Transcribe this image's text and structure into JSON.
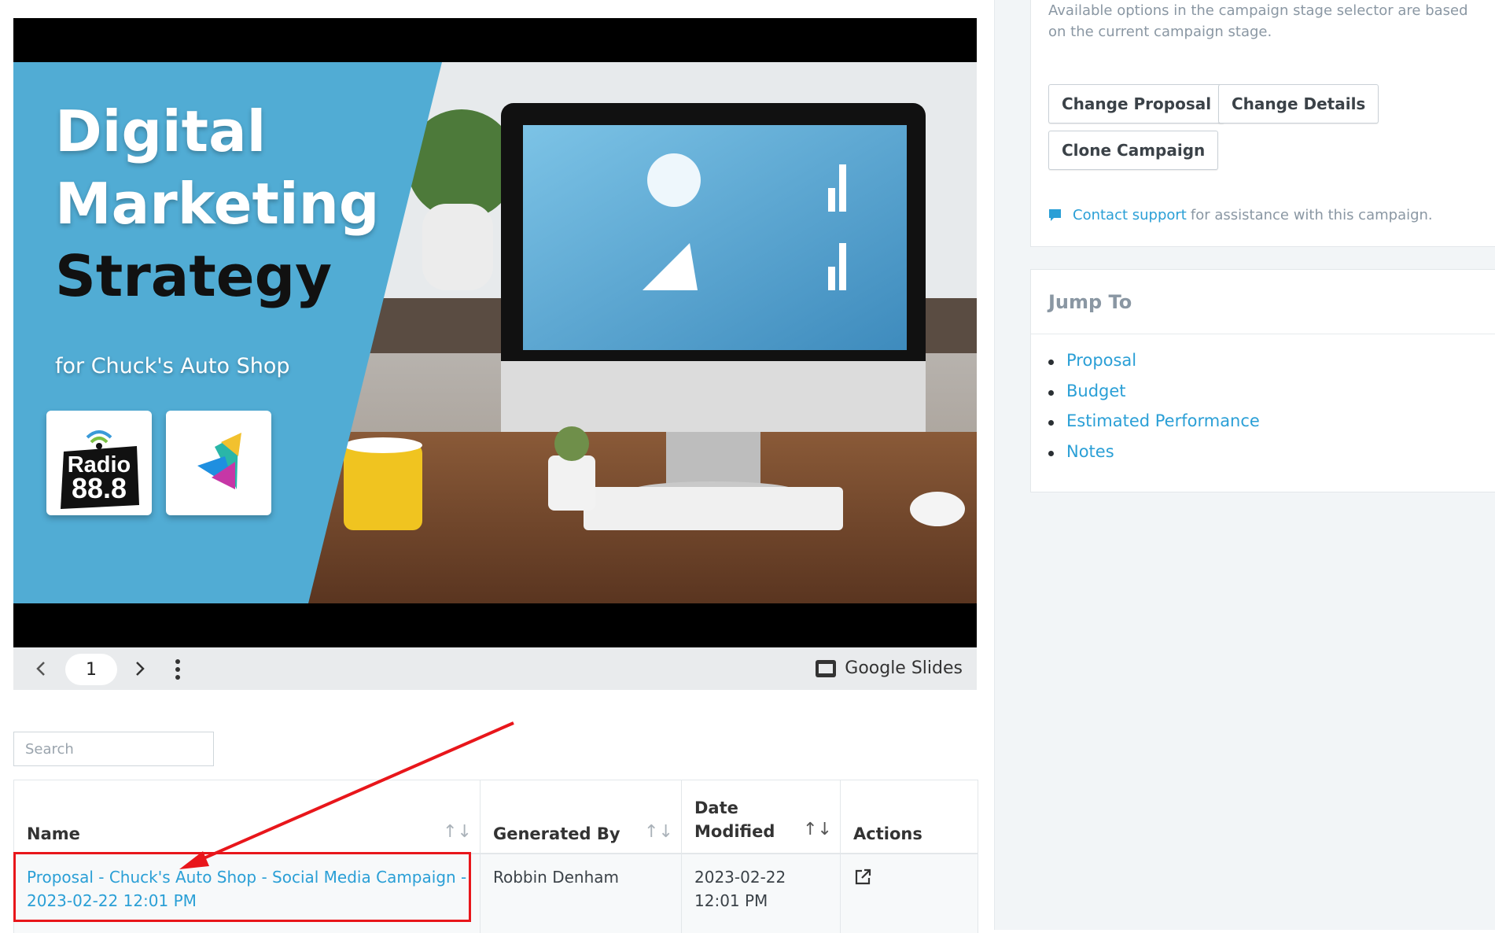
{
  "side_panel": {
    "stage_note": "Available options in the campaign stage selector are based on the current campaign stage.",
    "buttons": {
      "change_proposal": "Change Proposal",
      "change_details": "Change Details",
      "clone_campaign": "Clone Campaign"
    },
    "support": {
      "link": "Contact support",
      "text": "for assistance with this campaign."
    },
    "jump_to": {
      "title": "Jump To",
      "items": [
        "Proposal",
        "Budget",
        "Estimated Performance",
        "Notes"
      ]
    }
  },
  "slide": {
    "title_line1": "Digital",
    "title_line2": "Marketing",
    "title_line3": "Strategy",
    "subtitle": "for Chuck's Auto Shop",
    "logo_text_1": "Radio",
    "logo_text_2": "88.8",
    "page": "1",
    "provider": "Google Slides"
  },
  "search": {
    "placeholder": "Search"
  },
  "table": {
    "headers": {
      "name": "Name",
      "generated_by": "Generated By",
      "date_line1": "Date",
      "date_line2": "Modified",
      "actions": "Actions"
    },
    "rows": [
      {
        "name": "Proposal - Chuck's Auto Shop - Social Media Campaign - 2023-02-22 12:01 PM",
        "generated_by": "Robbin Denham",
        "date_modified": "2023-02-22 12:01 PM"
      }
    ]
  },
  "colors": {
    "link": "#2a9fd6",
    "annotation": "#e8161b",
    "slide_blue": "#51acd4"
  }
}
